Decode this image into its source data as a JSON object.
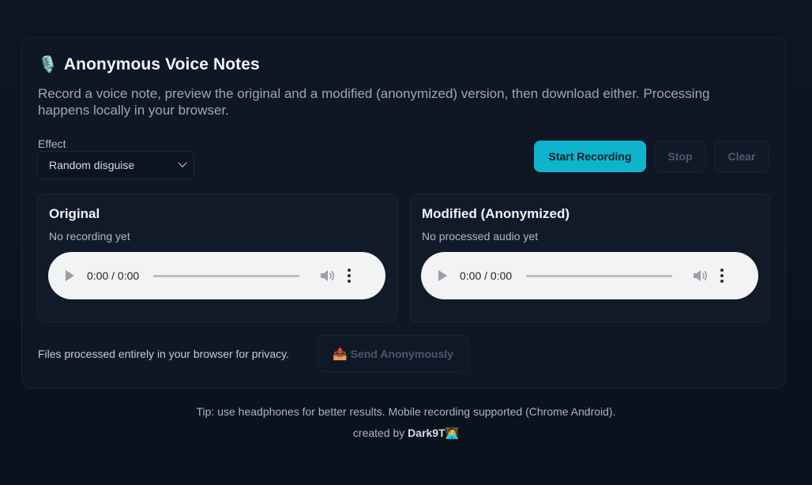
{
  "app": {
    "icon": "microphone-icon",
    "title": "Anonymous Voice Notes",
    "description": "Record a voice note, preview the original and a modified (anonymized) version, then download either. Processing happens locally in your browser."
  },
  "controls": {
    "effect_label": "Effect",
    "effect_selected": "Random disguise",
    "start_label": "Start Recording",
    "stop_label": "Stop",
    "clear_label": "Clear",
    "accent_color": "#0fb3cc"
  },
  "panels": [
    {
      "title": "Original",
      "status": "No recording yet",
      "time": "0:00 / 0:00"
    },
    {
      "title": "Modified (Anonymized)",
      "status": "No processed audio yet",
      "time": "0:00 / 0:00"
    }
  ],
  "footer": {
    "note": "Files processed entirely in your browser for privacy.",
    "send_icon": "outbox-tray-icon",
    "send_label": "Send Anonymously"
  },
  "tip": "Tip: use headphones for better results. Mobile recording supported (Chrome Android).",
  "credit": {
    "prefix": "created by",
    "author": "Dark9T",
    "icon": "hacker-emoji-icon"
  }
}
